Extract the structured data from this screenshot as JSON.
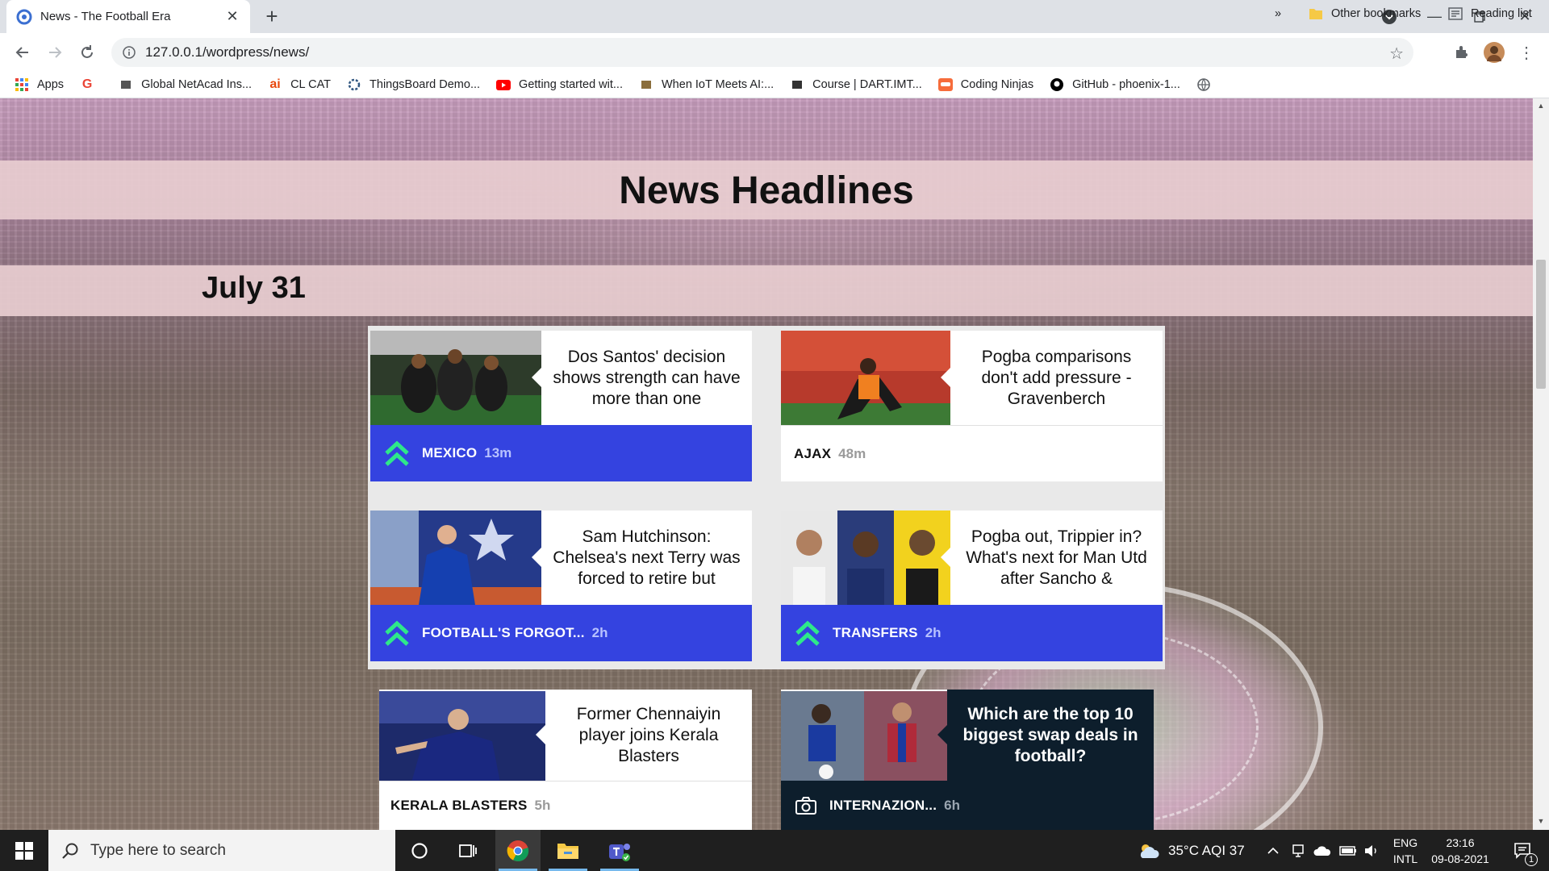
{
  "browser": {
    "tab_title": "News - The Football Era",
    "url": "127.0.0.1/wordpress/news/"
  },
  "bookmarks": [
    {
      "label": "Apps",
      "icon": "apps-grid-icon",
      "color": "#4285f4"
    },
    {
      "label": "",
      "icon": "google-icon",
      "color": "#ea4335"
    },
    {
      "label": "Global NetAcad Ins...",
      "icon": "cisco-icon",
      "color": "#555555"
    },
    {
      "label": "CL CAT",
      "icon": "ai-icon",
      "color": "#e8490f"
    },
    {
      "label": "ThingsBoard Demo...",
      "icon": "thingsboard-icon",
      "color": "#305680"
    },
    {
      "label": "Getting started wit...",
      "icon": "youtube-icon",
      "color": "#ff0000"
    },
    {
      "label": "When IoT Meets AI:...",
      "icon": "person-icon",
      "color": "#8a6d3b"
    },
    {
      "label": "Course | DART.IMT...",
      "icon": "dart-icon",
      "color": "#333333"
    },
    {
      "label": "Coding Ninjas",
      "icon": "coding-ninjas-icon",
      "color": "#f66c3b"
    },
    {
      "label": "GitHub - phoenix-1...",
      "icon": "github-icon",
      "color": "#000000"
    },
    {
      "label": "",
      "icon": "globe-icon",
      "color": "#5f6368"
    }
  ],
  "bookmarks_right": {
    "more": "»",
    "other": "Other bookmarks",
    "reading": "Reading list"
  },
  "page": {
    "title": "News Headlines",
    "date": "July 31"
  },
  "cards": [
    {
      "headline": "Dos Santos' decision shows strength can have more than one",
      "category": "MEXICO",
      "time": "13m",
      "style": "blue",
      "icon": "trending-up-icon"
    },
    {
      "headline": "Pogba comparisons don't add pressure - Gravenberch",
      "category": "AJAX",
      "time": "48m",
      "style": "white",
      "icon": ""
    },
    {
      "headline": "Sam Hutchinson: Chelsea's next Terry was forced to retire but",
      "category": "FOOTBALL'S FORGOT...",
      "time": "2h",
      "style": "blue",
      "icon": "trending-up-icon"
    },
    {
      "headline": "Pogba out, Trippier in? What's next for Man Utd after Sancho &",
      "category": "TRANSFERS",
      "time": "2h",
      "style": "blue",
      "icon": "trending-up-icon"
    },
    {
      "headline": "Former Chennaiyin player joins Kerala Blasters",
      "category": "KERALA BLASTERS",
      "time": "5h",
      "style": "white",
      "icon": ""
    },
    {
      "headline": "Which are the top 10 biggest swap deals in football?",
      "category": "INTERNAZION...",
      "time": "6h",
      "style": "dark",
      "icon": "camera-icon"
    }
  ],
  "taskbar": {
    "search_placeholder": "Type here to search",
    "weather": "35°C  AQI 37",
    "lang_top": "ENG",
    "lang_bottom": "INTL",
    "time": "23:16",
    "date": "09-08-2021",
    "notifications": "1"
  },
  "colors": {
    "accent_blue": "#3443e0",
    "trend_green": "#2ee88a",
    "dark_navy": "#0d1e2c"
  }
}
